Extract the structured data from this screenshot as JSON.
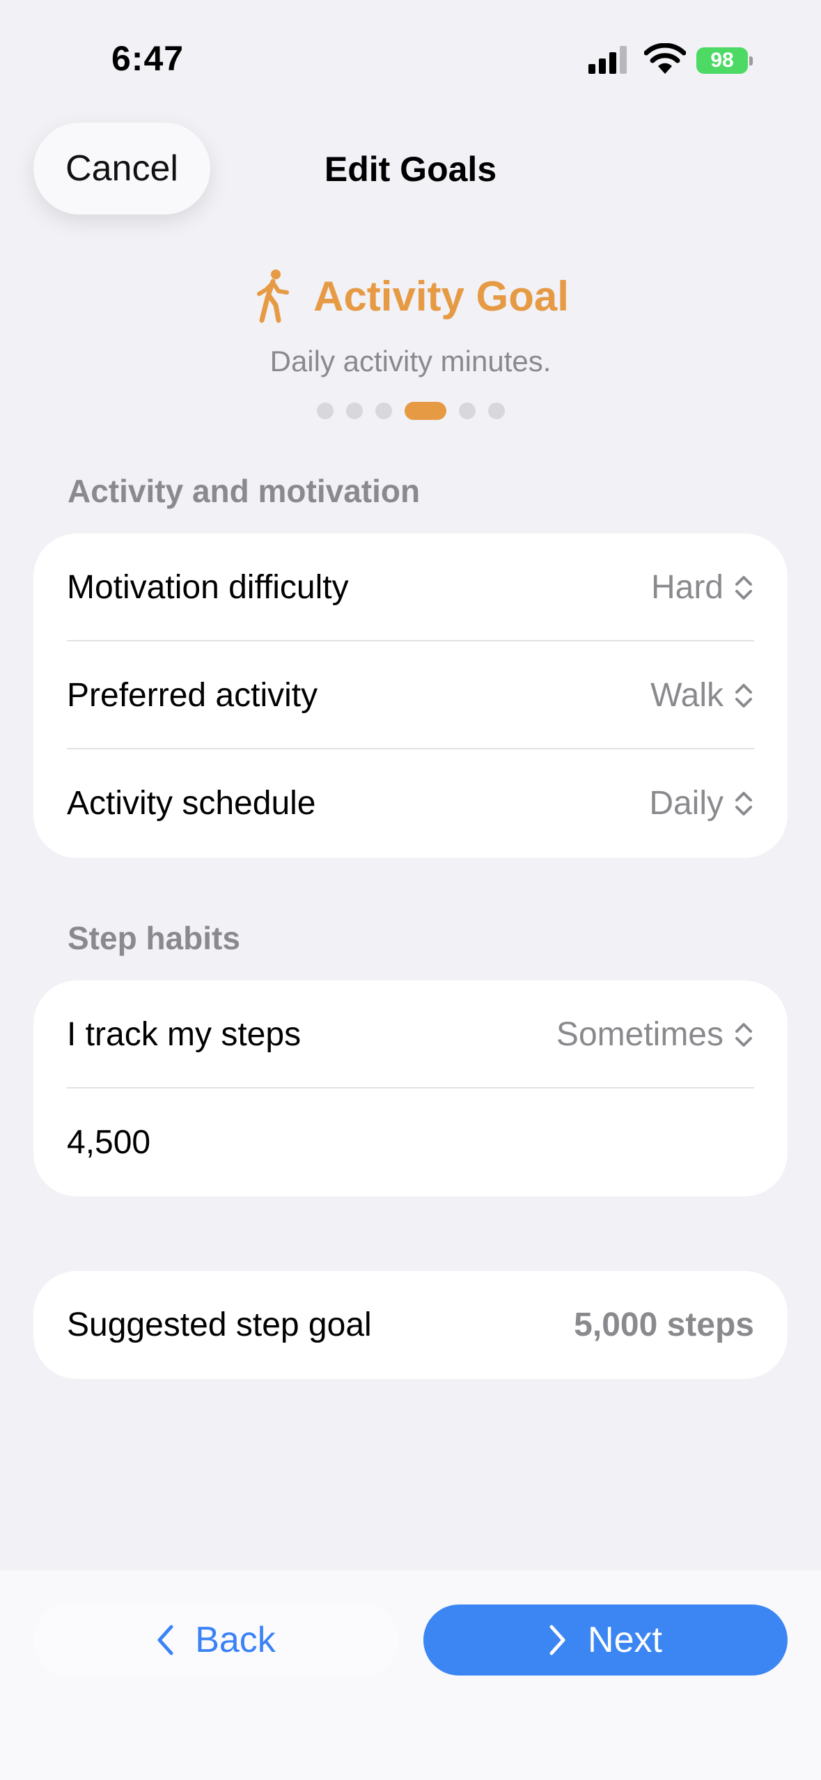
{
  "status_bar": {
    "time": "6:47",
    "battery": "98",
    "battery_color": "#4cd964"
  },
  "nav": {
    "cancel_label": "Cancel",
    "title": "Edit Goals"
  },
  "header": {
    "icon": "figure-walk-icon",
    "title": "Activity Goal",
    "subtitle": "Daily activity minutes.",
    "accent_color": "#e69a43",
    "page_indicator": {
      "total": 6,
      "current": 4
    }
  },
  "sections": [
    {
      "label": "Activity and motivation",
      "rows": [
        {
          "label": "Motivation difficulty",
          "value": "Hard"
        },
        {
          "label": "Preferred activity",
          "value": "Walk"
        },
        {
          "label": "Activity schedule",
          "value": "Daily"
        }
      ]
    },
    {
      "label": "Step habits",
      "rows": [
        {
          "label": "I track my steps",
          "value": "Sometimes"
        },
        {
          "value": "4,500"
        }
      ]
    }
  ],
  "suggestion": {
    "label": "Suggested step goal",
    "value": "5,000 steps"
  },
  "footer": {
    "back_label": "Back",
    "next_label": "Next",
    "next_color": "#3b86f3"
  }
}
